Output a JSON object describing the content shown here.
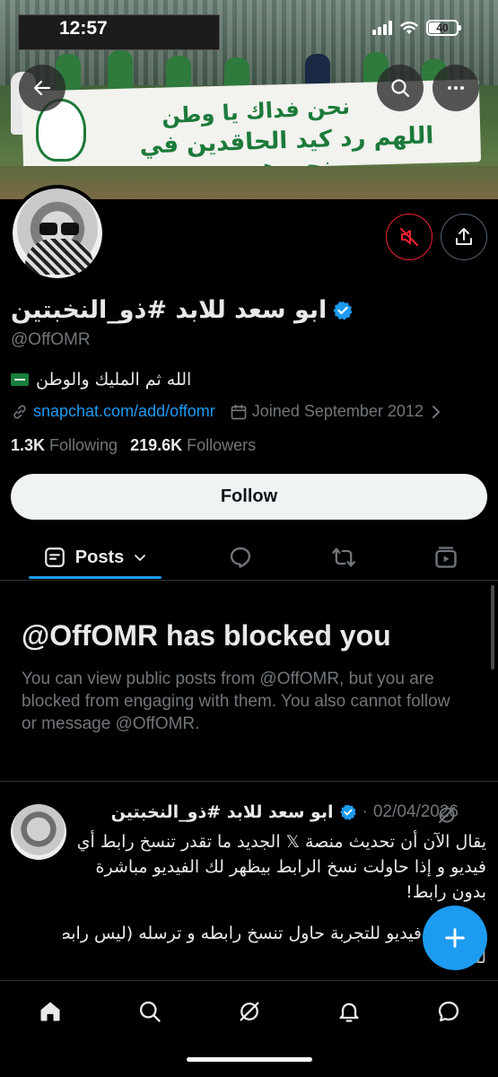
{
  "status_bar": {
    "time": "12:57",
    "battery": "40"
  },
  "profile": {
    "display_name": "ابو سعد للابد #ذو_النخبتين",
    "verified": true,
    "handle": "@OffOMR",
    "bio": "الله ثم المليك والوطن",
    "link": "snapchat.com/add/offomr",
    "joined": "Joined September 2012",
    "following_count": "1.3K",
    "following_label": "Following",
    "followers_count": "219.6K",
    "followers_label": "Followers"
  },
  "banner": {
    "flag_line1": "نحن فداك يا وطن",
    "flag_line2": "اللهم رد كيد الحاقدين في نحورهم"
  },
  "actions": {
    "follow_label": "Follow"
  },
  "tabs": {
    "posts_label": "Posts"
  },
  "blocked": {
    "title": "@OffOMR has blocked you",
    "description": "You can view public posts from @OffOMR, but you are blocked from engaging with them. You also cannot follow or message @OffOMR."
  },
  "post": {
    "author": "ابو سعد للابد #ذو_النخبتين",
    "date": "02/04/2026",
    "separator": "·",
    "text": "يقال الآن أن تحديث منصة 𝕏 الجديد ما تقدر تنسخ رابط أي فيديو و إذا حاولت نسخ الرابط بيظهر لك الفيديو مباشرة بدون رابط!",
    "text2": "فيديو للتجربة حاول تنسخ رابطه و ترسله (ليس رابط",
    "text3": "لفيديو)"
  },
  "colors": {
    "accent": "#1d9bf0",
    "muted": "#71767b",
    "danger": "#f4212e"
  }
}
